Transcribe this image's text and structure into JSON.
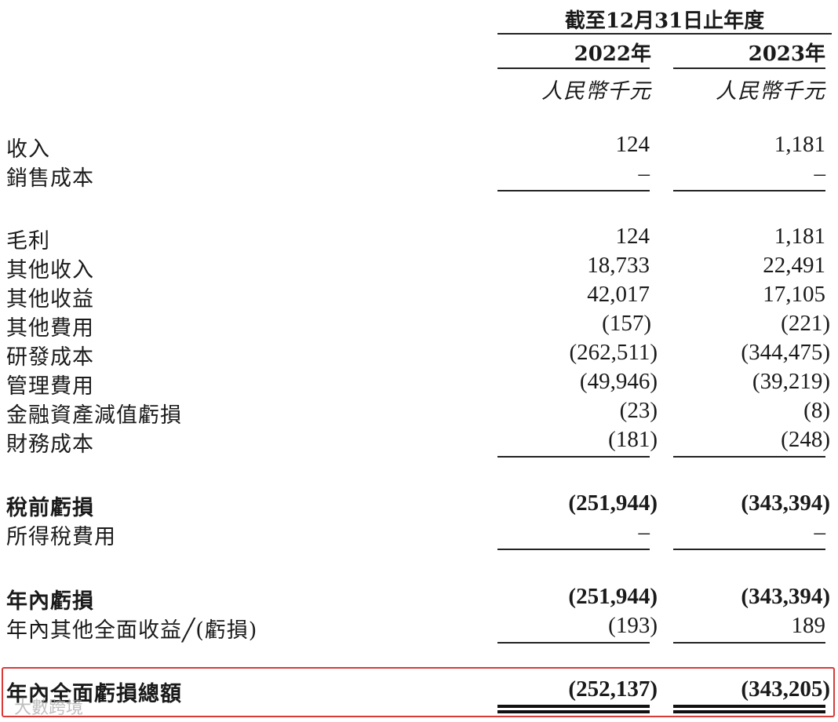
{
  "header": {
    "period": "截至12月31日止年度",
    "col1_year": "2022年",
    "col2_year": "2023年",
    "col1_unit": "人民幣千元",
    "col2_unit": "人民幣千元"
  },
  "rows": [
    {
      "label": "收入",
      "v2022": "124",
      "v2023": "1,181"
    },
    {
      "label": "銷售成本",
      "v2022": "–",
      "v2023": "–"
    },
    {
      "label": "毛利",
      "v2022": "124",
      "v2023": "1,181"
    },
    {
      "label": "其他收入",
      "v2022": "18,733",
      "v2023": "22,491"
    },
    {
      "label": "其他收益",
      "v2022": "42,017",
      "v2023": "17,105"
    },
    {
      "label": "其他費用",
      "v2022": "(157)",
      "v2023": "(221)"
    },
    {
      "label": "研發成本",
      "v2022": "(262,511)",
      "v2023": "(344,475)"
    },
    {
      "label": "管理費用",
      "v2022": "(49,946)",
      "v2023": "(39,219)"
    },
    {
      "label": "金融資產減值虧損",
      "v2022": "(23)",
      "v2023": "(8)"
    },
    {
      "label": "財務成本",
      "v2022": "(181)",
      "v2023": "(248)"
    },
    {
      "label": "稅前虧損",
      "v2022": "(251,944)",
      "v2023": "(343,394)"
    },
    {
      "label": "所得稅費用",
      "v2022": "–",
      "v2023": "–"
    },
    {
      "label": "年內虧損",
      "v2022": "(251,944)",
      "v2023": "(343,394)"
    },
    {
      "label": "年內其他全面收益╱(虧損)",
      "v2022": "(193)",
      "v2023": "189"
    },
    {
      "label": "年內全面虧損總額",
      "v2022": "(252,137)",
      "v2023": "(343,205)"
    }
  ],
  "watermark": "大數跨境"
}
